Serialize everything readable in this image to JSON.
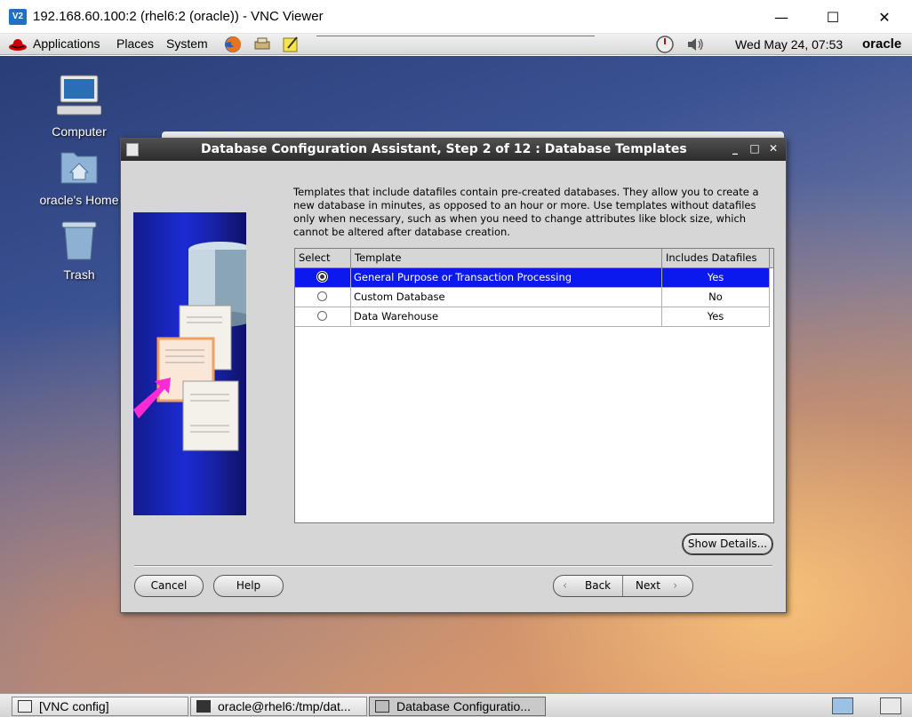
{
  "vnc": {
    "title": "192.168.60.100:2 (rhel6:2 (oracle)) - VNC Viewer",
    "icon_text": "V2",
    "minimize_glyph": "—",
    "maximize_glyph": "☐",
    "close_glyph": "✕"
  },
  "panel": {
    "menus": [
      "Applications",
      "Places",
      "System"
    ],
    "clock": "Wed May 24, 07:53",
    "user": "oracle",
    "launchers": [
      "firefox-icon",
      "network-icon",
      "notes-icon"
    ],
    "tray": [
      "performance-icon",
      "volume-icon"
    ]
  },
  "desktop": {
    "icons": [
      {
        "label": "Computer"
      },
      {
        "label": "oracle's Home"
      },
      {
        "label": "Trash"
      }
    ]
  },
  "dialog": {
    "title": "Database Configuration Assistant, Step 2 of 12 : Database Templates",
    "controls": {
      "minimize": "_",
      "maximize": "□",
      "close": "✕"
    },
    "intro": "Templates that include datafiles contain pre-created databases. They allow you to create a new database in minutes, as opposed to an hour or more. Use templates without datafiles only when necessary, such as when you need to change attributes like block size, which cannot be altered after database creation.",
    "table": {
      "headers": [
        "Select",
        "Template",
        "Includes Datafiles"
      ],
      "rows": [
        {
          "template": "General Purpose or Transaction Processing",
          "includes": "Yes",
          "selected": true
        },
        {
          "template": "Custom Database",
          "includes": "No",
          "selected": false
        },
        {
          "template": "Data Warehouse",
          "includes": "Yes",
          "selected": false
        }
      ]
    },
    "buttons": {
      "show_details": "Show Details...",
      "cancel": "Cancel",
      "help": "Help",
      "back": "Back",
      "next": "Next"
    },
    "selection_color": "#0c19ee"
  },
  "taskbar": {
    "tasks": [
      {
        "label": "[VNC config]"
      },
      {
        "label": "oracle@rhel6:/tmp/dat..."
      },
      {
        "label": "Database Configuratio..."
      }
    ]
  }
}
